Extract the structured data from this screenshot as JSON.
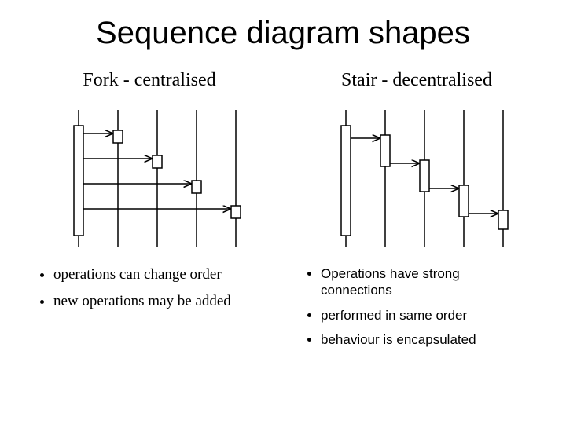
{
  "title": "Sequence diagram shapes",
  "left": {
    "subtitle": "Fork - centralised",
    "bullets": [
      "operations can change order",
      "new operations may be added"
    ]
  },
  "right": {
    "subtitle": "Stair - decentralised",
    "bullets": [
      "Operations have strong connections",
      "performed in same order",
      "behaviour is encapsulated"
    ]
  }
}
